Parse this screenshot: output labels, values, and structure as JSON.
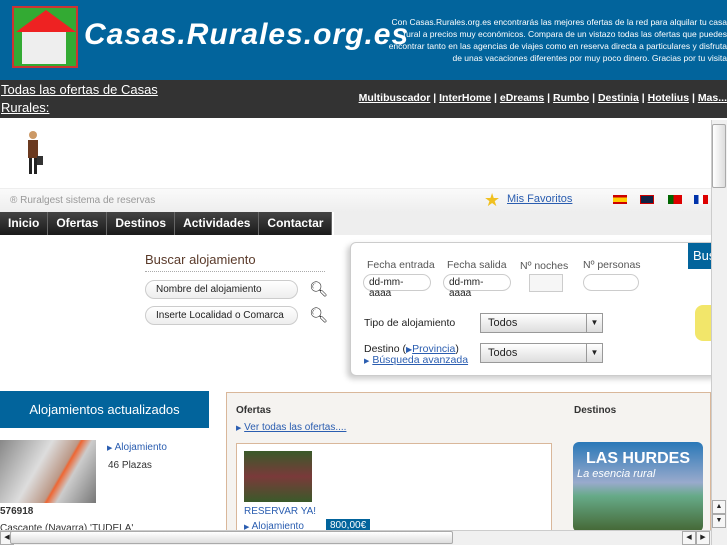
{
  "header": {
    "logo": "Casas.Rurales.org.es",
    "intro_lines": [
      "Con Casas.Rurales.org.es encontrarás las mejores ofertas de la red para alquilar tu casa",
      "rural a precios muy económicos. Compara de un vistazo todas las ofertas que puedes",
      "encontrar tanto en las agencias de viajes como en reserva directa a particulares y disfruta",
      "de unas vacaciones diferentes por muy poco dinero. Gracias por tu visita"
    ]
  },
  "bar": {
    "title": "Todas las ofertas de Casas Rurales:",
    "links": [
      "Multibuscador",
      "InterHome",
      "eDreams",
      "Rumbo",
      "Destinia",
      "Hotelius",
      "Mas..."
    ]
  },
  "strip": {
    "ruralgest": "® Ruralgest sistema de reservas",
    "favorites": "Mis Favoritos"
  },
  "nav": [
    "Inicio",
    "Ofertas",
    "Destinos",
    "Actividades",
    "Contactar"
  ],
  "search": {
    "title": "Buscar alojamiento",
    "name_placeholder": "Nombre del alojamiento",
    "location_placeholder": "Inserte Localidad o Comarca"
  },
  "booking": {
    "checkin_label": "Fecha entrada",
    "checkout_label": "Fecha salida",
    "nights_label": "Nº noches",
    "persons_label": "Nº personas",
    "date_placeholder": "dd-mm-aaaa",
    "type_label": "Tipo de alojamiento",
    "type_value": "Todos",
    "dest_label": "Destino (",
    "dest_link": "Provincia",
    "dest_close": ")",
    "dest_value": "Todos",
    "advanced": "Búsqueda avanzada",
    "tab": "Bus"
  },
  "updated": {
    "title": "Alojamientos actualizados",
    "link": "Alojamiento",
    "places": "46 Plazas",
    "id": "576918",
    "location": "Cascante (Navarra) 'TUDELA'"
  },
  "offers": {
    "title": "Ofertas",
    "see_all": "Ver todas las ofertas....",
    "reserve": "RESERVAR YA!",
    "link": "Alojamiento",
    "price": "800,00€"
  },
  "destinations": {
    "title": "Destinos",
    "banner_title": "LAS HURDES",
    "banner_sub": "La esencia rural"
  }
}
